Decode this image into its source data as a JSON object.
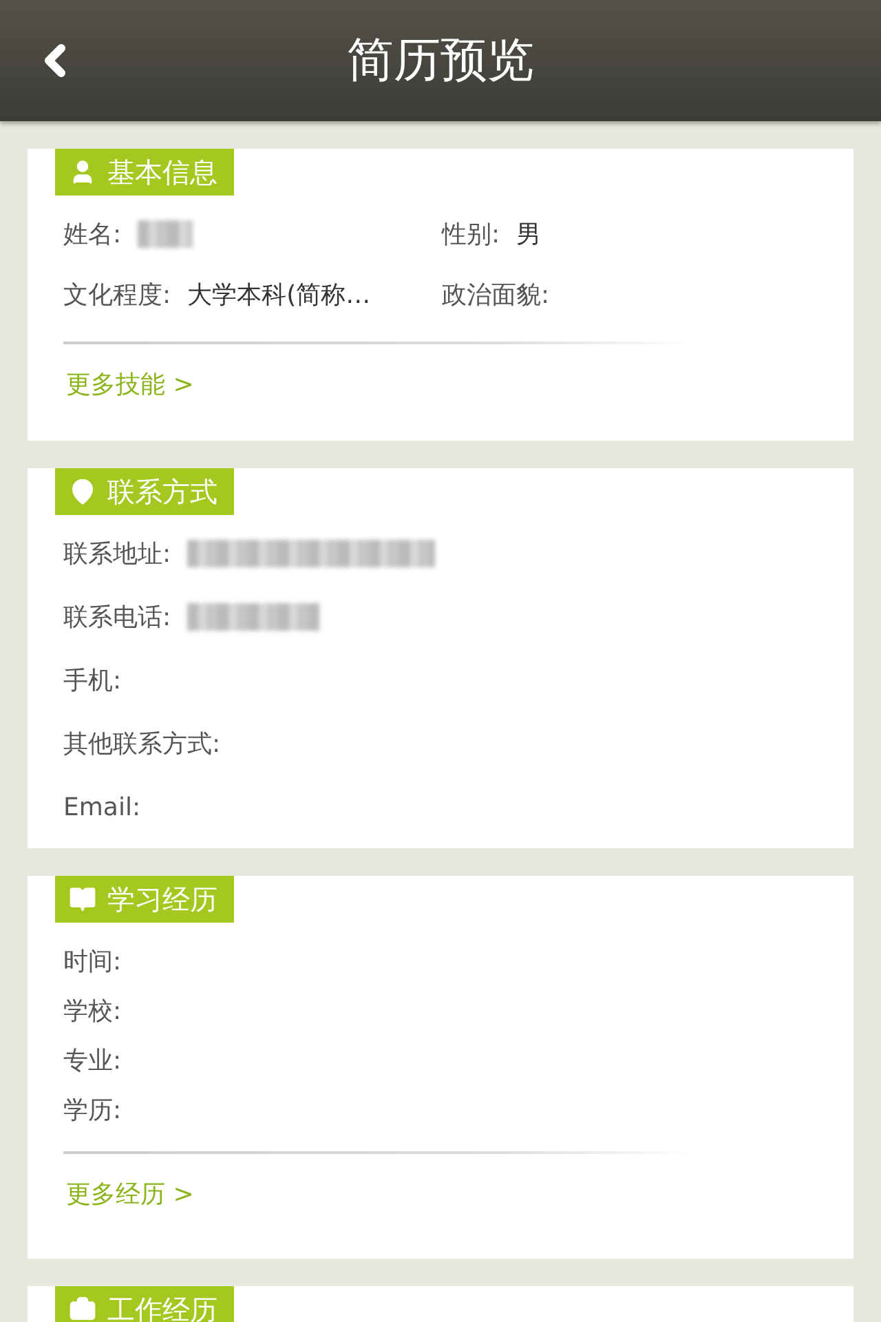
{
  "header": {
    "title": "简历预览"
  },
  "sections": [
    {
      "title": "基本信息",
      "fields": [
        {
          "label": "姓名:",
          "redacted": true
        },
        {
          "label": "性别:",
          "value": "男"
        },
        {
          "label": "文化程度:",
          "value": "大学本科(简称…"
        },
        {
          "label": "政治面貌:"
        }
      ],
      "link": "更多技能 >"
    },
    {
      "title": "联系方式",
      "fields": [
        {
          "label": "联系地址:",
          "redacted": true
        },
        {
          "label": "联系电话:",
          "redacted": true
        },
        {
          "label": "手机:"
        },
        {
          "label": "其他联系方式:"
        },
        {
          "label": "Email:"
        }
      ]
    },
    {
      "title": "学习经历",
      "fields": [
        {
          "label": "时间:"
        },
        {
          "label": "学校:"
        },
        {
          "label": "专业:"
        },
        {
          "label": "学历:"
        }
      ],
      "link": "更多经历 >"
    },
    {
      "title": "工作经历"
    }
  ]
}
